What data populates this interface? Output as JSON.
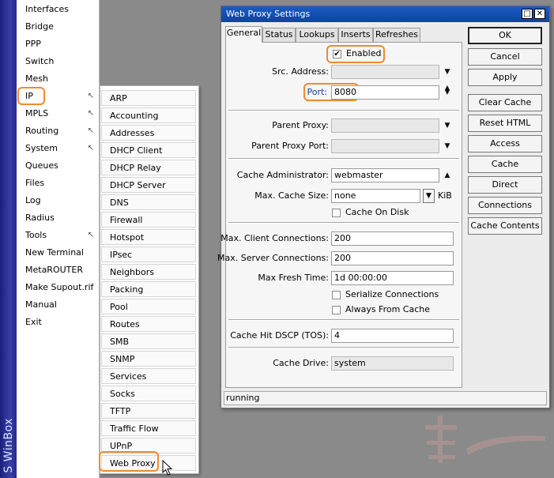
{
  "brand": "S WinBox",
  "main_menu": {
    "items": [
      {
        "label": "Interfaces"
      },
      {
        "label": "Bridge"
      },
      {
        "label": "PPP"
      },
      {
        "label": "Switch"
      },
      {
        "label": "Mesh"
      },
      {
        "label": "IP",
        "submenu": true
      },
      {
        "label": "MPLS",
        "submenu": true
      },
      {
        "label": "Routing",
        "submenu": true
      },
      {
        "label": "System",
        "submenu": true
      },
      {
        "label": "Queues"
      },
      {
        "label": "Files"
      },
      {
        "label": "Log"
      },
      {
        "label": "Radius"
      },
      {
        "label": "Tools",
        "submenu": true
      },
      {
        "label": "New Terminal"
      },
      {
        "label": "MetaROUTER"
      },
      {
        "label": "Make Supout.rif"
      },
      {
        "label": "Manual"
      },
      {
        "label": "Exit"
      }
    ]
  },
  "ip_menu": {
    "items": [
      "ARP",
      "Accounting",
      "Addresses",
      "DHCP Client",
      "DHCP Relay",
      "DHCP Server",
      "DNS",
      "Firewall",
      "Hotspot",
      "IPsec",
      "Neighbors",
      "Packing",
      "Pool",
      "Routes",
      "SMB",
      "SNMP",
      "Services",
      "Socks",
      "TFTP",
      "Traffic Flow",
      "UPnP",
      "Web Proxy"
    ]
  },
  "dialog": {
    "title": "Web Proxy Settings",
    "minimize_glyph": "□",
    "close_glyph": "✕",
    "tabs": [
      "General",
      "Status",
      "Lookups",
      "Inserts",
      "Refreshes"
    ],
    "enabled_label": "Enabled",
    "enabled_check": "✔",
    "src_address_label": "Src. Address:",
    "src_address_value": "",
    "port_label": "Port:",
    "port_value": "8080",
    "parent_proxy_label": "Parent Proxy:",
    "parent_proxy_value": "",
    "parent_proxy_port_label": "Parent Proxy Port:",
    "parent_proxy_port_value": "",
    "cache_admin_label": "Cache Administrator:",
    "cache_admin_value": "webmaster",
    "max_cache_size_label": "Max. Cache Size:",
    "max_cache_size_value": "none",
    "max_cache_size_unit": "KiB",
    "cache_on_disk_label": "Cache On Disk",
    "max_client_conn_label": "Max. Client Connections:",
    "max_client_conn_value": "200",
    "max_server_conn_label": "Max. Server Connections:",
    "max_server_conn_value": "200",
    "max_fresh_time_label": "Max Fresh Time:",
    "max_fresh_time_value": "1d 00:00:00",
    "serialize_label": "Serialize Connections",
    "always_from_cache_label": "Always From Cache",
    "cache_hit_dscp_label": "Cache Hit DSCP (TOS):",
    "cache_hit_dscp_value": "4",
    "cache_drive_label": "Cache Drive:",
    "cache_drive_value": "system",
    "buttons": [
      "OK",
      "Cancel",
      "Apply",
      "Clear Cache",
      "Reset HTML",
      "Access",
      "Cache",
      "Direct",
      "Connections",
      "Cache Contents"
    ],
    "status": "running"
  },
  "colors": {
    "highlight": "#ef8a2e",
    "title_bar": "#1a5cc3",
    "port_label": "#1a3fa0"
  },
  "icons": {
    "submenu_arrow": "submenu-arrow-icon",
    "dropdown": "dropdown-arrow-icon",
    "up": "up-arrow-icon",
    "spinner": "spinner-icon",
    "cursor": "mouse-cursor-icon"
  }
}
